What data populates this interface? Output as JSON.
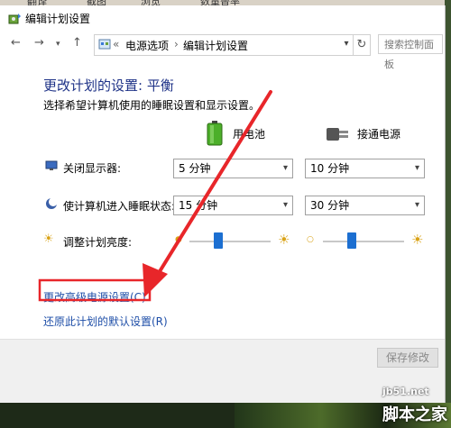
{
  "window": {
    "title": "编辑计划设置",
    "background_tabs": [
      "翻译",
      "截图",
      "浏览",
      "数量替率"
    ]
  },
  "nav": {
    "back_icon": "arrow-left-icon",
    "forward_icon": "arrow-right-icon",
    "up_icon": "arrow-up-icon",
    "breadcrumb_prefix": "«",
    "breadcrumb": [
      "电源选项",
      "编辑计划设置"
    ],
    "breadcrumb_sep": "›",
    "search_placeholder": "搜索控制面板"
  },
  "main": {
    "heading": "更改计划的设置: 平衡",
    "subtext": "选择希望计算机使用的睡眠设置和显示设置。",
    "columns": [
      "用电池",
      "接通电源"
    ],
    "rows": [
      {
        "label": "关闭显示器:",
        "battery": "5 分钟",
        "plugged": "10 分钟"
      },
      {
        "label": "使计算机进入睡眠状态:",
        "battery": "15 分钟",
        "plugged": "30 分钟"
      }
    ],
    "brightness": {
      "label": "调整计划亮度:",
      "battery_level": 0.35,
      "plugged_level": 0.35
    },
    "advanced_link": "更改高级电源设置(C)",
    "restore_link": "还原此计划的默认设置(R)"
  },
  "footer": {
    "save_label": "保存修改"
  },
  "annotation": {
    "arrow_color": "#e8262a",
    "box_color": "#e8262a"
  },
  "watermark": {
    "line1": "jb51.net",
    "line2": "脚本之家"
  }
}
